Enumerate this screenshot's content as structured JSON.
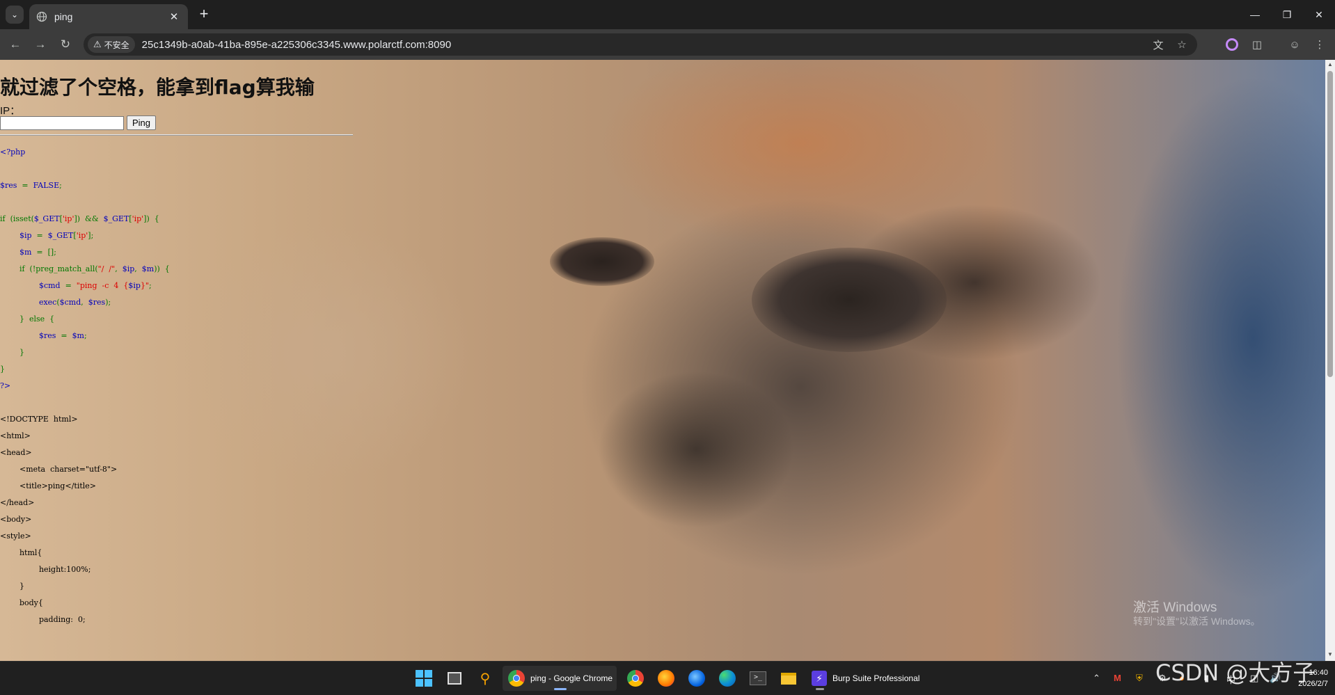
{
  "browser": {
    "tab_title": "ping",
    "address_security_label": "不安全",
    "url": "25c1349b-a0ab-41ba-895e-a225306c3345.www.polarctf.com:8090"
  },
  "page": {
    "heading": "就过滤了个空格，能拿到flag算我输",
    "ip_label": "IP：",
    "ip_input_value": "",
    "ping_button": "Ping",
    "source_code": [
      [
        [
          "c-blue",
          "<?php"
        ]
      ],
      [],
      [
        [
          "c-blue",
          "$res"
        ],
        [
          "c-green",
          "  =  "
        ],
        [
          "c-blue",
          "FALSE"
        ],
        [
          "c-green",
          ";"
        ]
      ],
      [],
      [
        [
          "c-green",
          "if  (isset("
        ],
        [
          "c-blue",
          "$_GET"
        ],
        [
          "c-green",
          "["
        ],
        [
          "c-red",
          "'ip'"
        ],
        [
          "c-green",
          "])  &&  "
        ],
        [
          "c-blue",
          "$_GET"
        ],
        [
          "c-green",
          "["
        ],
        [
          "c-red",
          "'ip'"
        ],
        [
          "c-green",
          "])  {"
        ]
      ],
      [
        [
          "c-blue",
          "        $ip"
        ],
        [
          "c-green",
          "  =  "
        ],
        [
          "c-blue",
          "$_GET"
        ],
        [
          "c-green",
          "["
        ],
        [
          "c-red",
          "'ip'"
        ],
        [
          "c-green",
          "];"
        ]
      ],
      [
        [
          "c-blue",
          "        $m"
        ],
        [
          "c-green",
          "  =  [];"
        ]
      ],
      [
        [
          "c-green",
          "        if  (!preg_match_all("
        ],
        [
          "c-red",
          "\"/  /\""
        ],
        [
          "c-green",
          ",  "
        ],
        [
          "c-blue",
          "$ip"
        ],
        [
          "c-green",
          ",  "
        ],
        [
          "c-blue",
          "$m"
        ],
        [
          "c-green",
          "))  {"
        ]
      ],
      [
        [
          "c-blue",
          "                $cmd"
        ],
        [
          "c-green",
          "  =  "
        ],
        [
          "c-red",
          "\"ping  -c  4  {"
        ],
        [
          "c-blue",
          "$ip"
        ],
        [
          "c-red",
          "}\""
        ],
        [
          "c-green",
          ";"
        ]
      ],
      [
        [
          "c-blue",
          "                exec"
        ],
        [
          "c-green",
          "("
        ],
        [
          "c-blue",
          "$cmd"
        ],
        [
          "c-green",
          ",  "
        ],
        [
          "c-blue",
          "$res"
        ],
        [
          "c-green",
          ");"
        ]
      ],
      [
        [
          "c-green",
          "        }  else  {"
        ]
      ],
      [
        [
          "c-blue",
          "                $res"
        ],
        [
          "c-green",
          "  =  "
        ],
        [
          "c-blue",
          "$m"
        ],
        [
          "c-green",
          ";"
        ]
      ],
      [
        [
          "c-green",
          "        }"
        ]
      ],
      [
        [
          "c-green",
          "}"
        ]
      ],
      [
        [
          "c-blue",
          "?>"
        ]
      ],
      [],
      [
        [
          "c-black",
          "<!DOCTYPE  html>"
        ]
      ],
      [
        [
          "c-black",
          "<html>"
        ]
      ],
      [
        [
          "c-black",
          "<head>"
        ]
      ],
      [
        [
          "c-black",
          "        <meta  charset=\"utf-8\">"
        ]
      ],
      [
        [
          "c-black",
          "        <title>ping</title>"
        ]
      ],
      [
        [
          "c-black",
          "</head>"
        ]
      ],
      [
        [
          "c-black",
          "<body>"
        ]
      ],
      [
        [
          "c-black",
          "<style>"
        ]
      ],
      [
        [
          "c-black",
          "        html{"
        ]
      ],
      [
        [
          "c-black",
          "                height:100%;"
        ]
      ],
      [
        [
          "c-black",
          "        }"
        ]
      ],
      [
        [
          "c-black",
          "        body{"
        ]
      ],
      [
        [
          "c-black",
          "                padding:  0;"
        ]
      ]
    ]
  },
  "watermark": {
    "line1": "激活 Windows",
    "line2": "转到\"设置\"以激活 Windows。"
  },
  "taskbar": {
    "chrome_window_label": "ping - Google Chrome",
    "burp_label": "Burp Suite Professional",
    "clock_time": "16:40",
    "clock_date": "2026/2/7",
    "csdn_watermark": "CSDN @大方子"
  }
}
